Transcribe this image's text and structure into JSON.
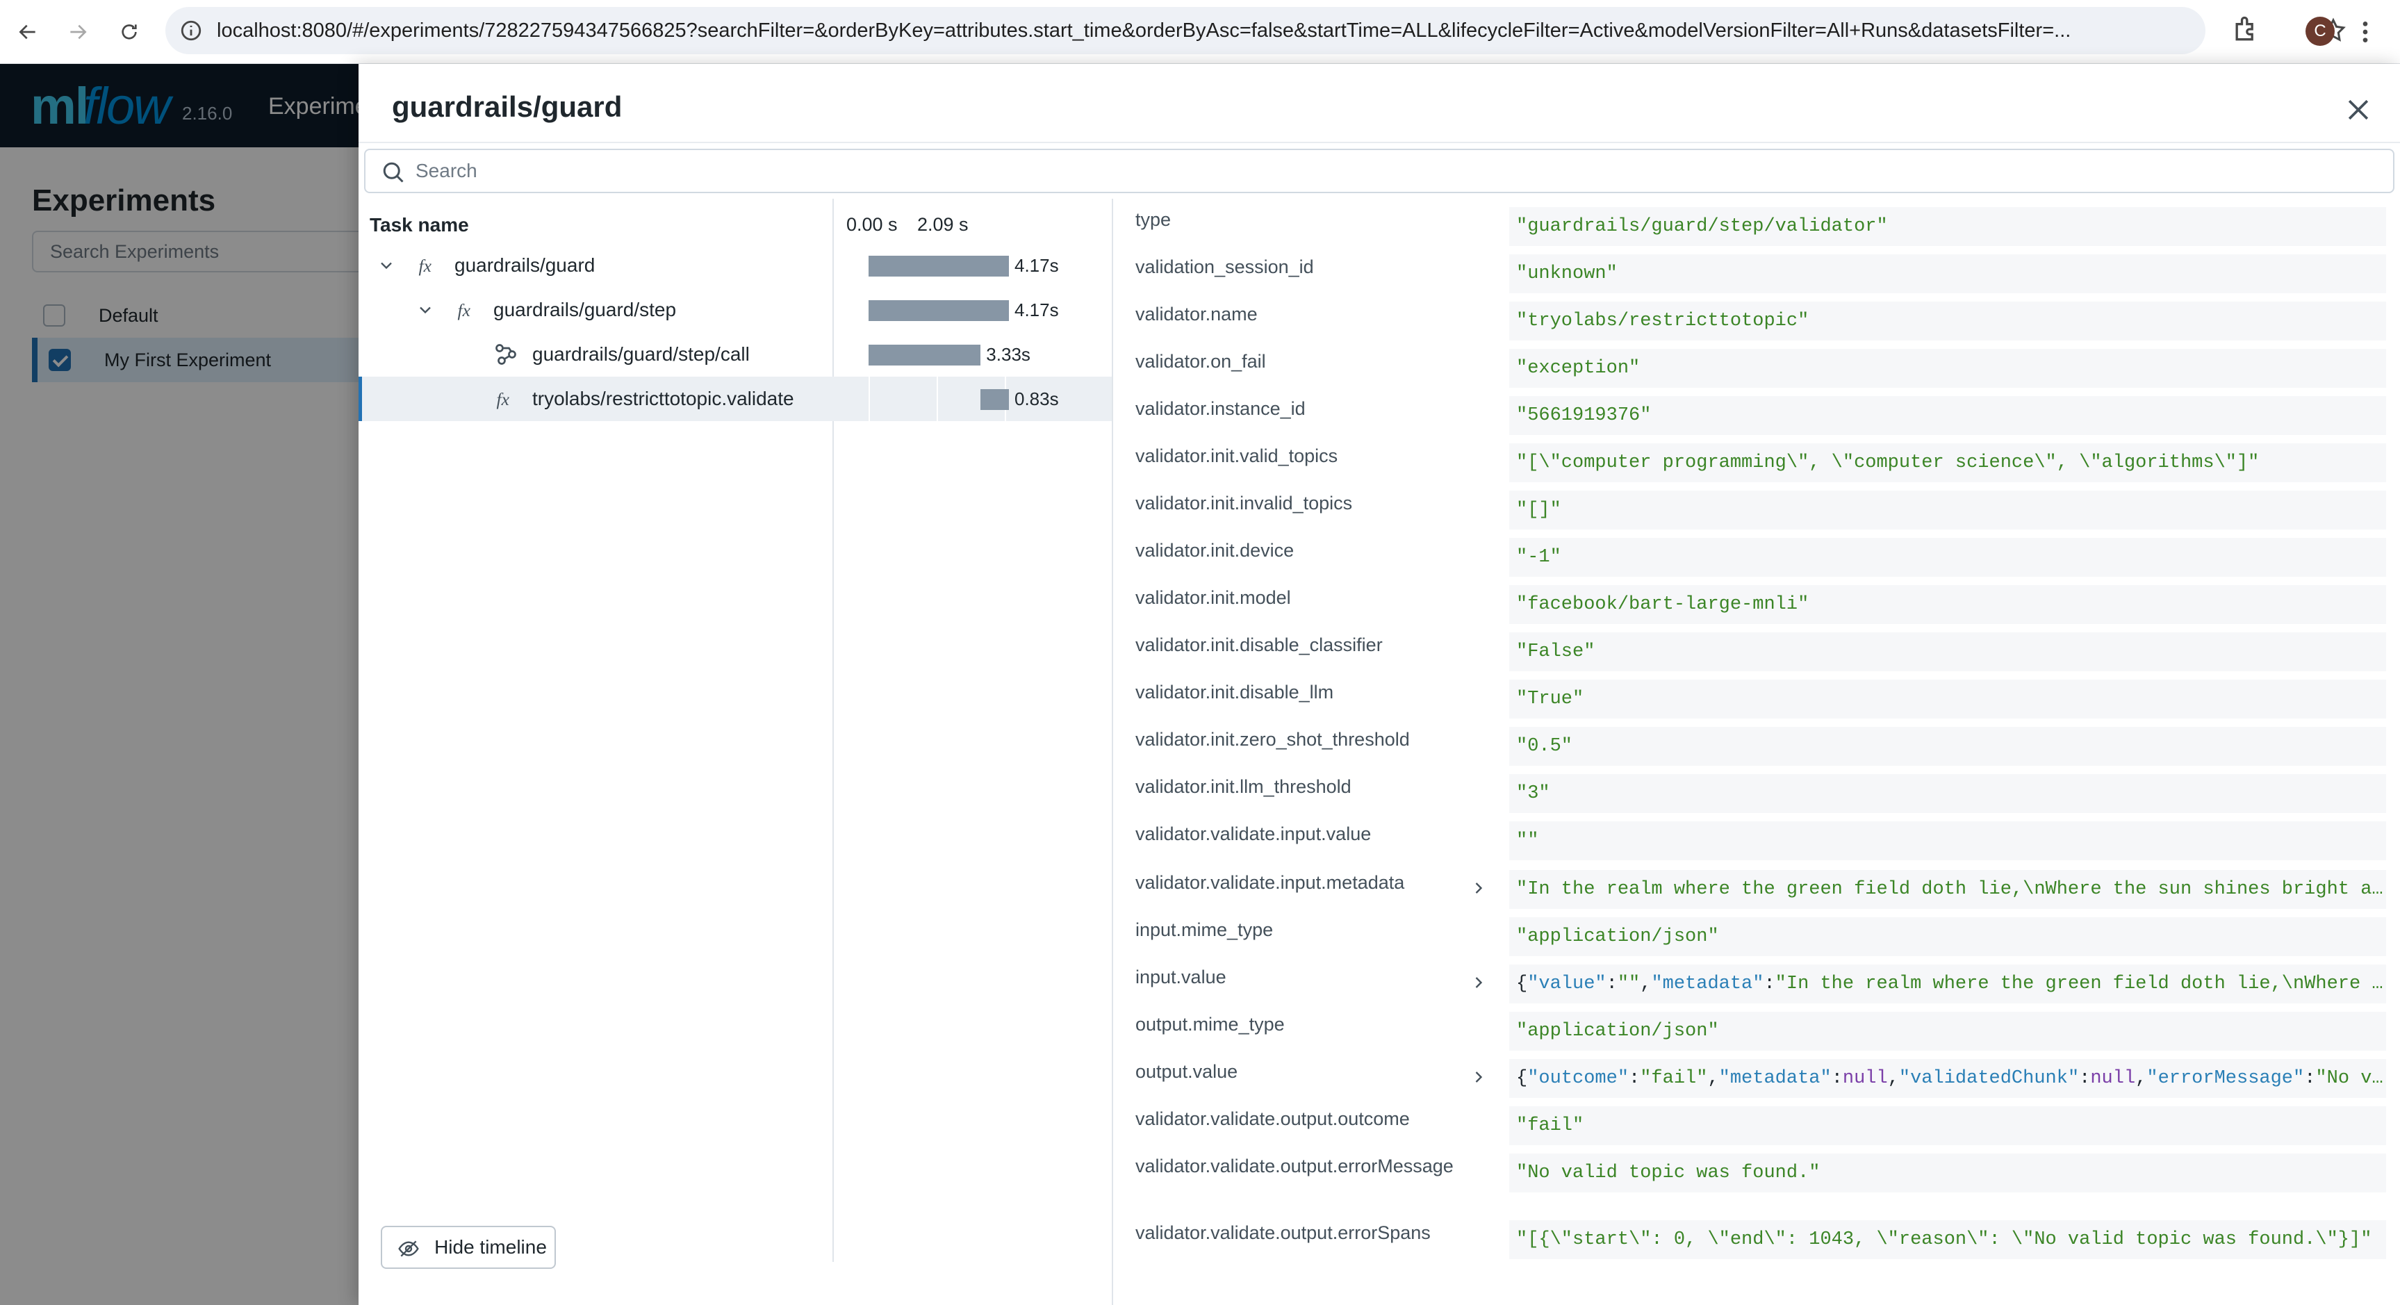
{
  "browser": {
    "url": "localhost:8080/#/experiments/728227594347566825?searchFilter=&orderByKey=attributes.start_time&orderByAsc=false&startTime=ALL&lifecycleFilter=Active&modelVersionFilter=All+Runs&datasetsFilter=...",
    "profile_initial": "C"
  },
  "app": {
    "logo_ml": "ml",
    "logo_flow": "flow",
    "version": "2.16.0",
    "nav_experiments": "Experiments",
    "experiments_title": "Experiments",
    "search_placeholder": "Search Experiments",
    "experiments": [
      {
        "label": "Default",
        "checked": false
      },
      {
        "label": "My First Experiment",
        "checked": true
      }
    ]
  },
  "drawer": {
    "title": "guardrails/guard",
    "search_placeholder": "Search",
    "task_name_header": "Task name",
    "timeline_start": "0.00 s",
    "timeline_mid": "2.09 s",
    "hide_timeline_label": "Hide timeline",
    "spans": [
      {
        "name": "guardrails/guard",
        "duration": "4.17s",
        "start": 0.0,
        "end": 4.17,
        "icon": "function-icon",
        "expandable": true
      },
      {
        "name": "guardrails/guard/step",
        "duration": "4.17s",
        "start": 0.0,
        "end": 4.17,
        "icon": "function-icon",
        "expandable": true
      },
      {
        "name": "guardrails/guard/step/call",
        "duration": "3.33s",
        "start": 0.0,
        "end": 3.33,
        "icon": "chain-icon",
        "expandable": false
      },
      {
        "name": "tryolabs/restricttotopic.validate",
        "duration": "0.83s",
        "start": 3.33,
        "end": 4.17,
        "icon": "function-icon",
        "expandable": false
      }
    ],
    "attributes": [
      {
        "key": "type",
        "value": "\"guardrails/guard/step/validator\"",
        "expandable": false
      },
      {
        "key": "validation_session_id",
        "value": "\"unknown\"",
        "expandable": false
      },
      {
        "key": "validator.name",
        "value": "\"tryolabs/restricttotopic\"",
        "expandable": false
      },
      {
        "key": "validator.on_fail",
        "value": "\"exception\"",
        "expandable": false
      },
      {
        "key": "validator.instance_id",
        "value": "\"5661919376\"",
        "expandable": false
      },
      {
        "key": "validator.init.valid_topics",
        "value": "\"[\\\"computer programming\\\", \\\"computer science\\\", \\\"algorithms\\\"]\"",
        "expandable": false
      },
      {
        "key": "validator.init.invalid_topics",
        "value": "\"[]\"",
        "expandable": false
      },
      {
        "key": "validator.init.device",
        "value": "\"-1\"",
        "expandable": false
      },
      {
        "key": "validator.init.model",
        "value": "\"facebook/bart-large-mnli\"",
        "expandable": false
      },
      {
        "key": "validator.init.disable_classifier",
        "value": "\"False\"",
        "expandable": false
      },
      {
        "key": "validator.init.disable_llm",
        "value": "\"True\"",
        "expandable": false
      },
      {
        "key": "validator.init.zero_shot_threshold",
        "value": "\"0.5\"",
        "expandable": false
      },
      {
        "key": "validator.init.llm_threshold",
        "value": "\"3\"",
        "expandable": false
      },
      {
        "key": "validator.validate.input.value",
        "value": "\"\"",
        "expandable": false
      },
      {
        "key": "validator.validate.input.metadata",
        "value": "\"In the realm where the green field doth lie,\\nWhere the sun shines bright and the sk…",
        "expandable": true
      },
      {
        "key": "input.mime_type",
        "value": "\"application/json\"",
        "expandable": false
      },
      {
        "key": "input.value",
        "value": "{\"value\":\"\",\"metadata\":\"In the realm where the green field doth lie,\\nWhere the sun s…",
        "expandable": true
      },
      {
        "key": "output.mime_type",
        "value": "\"application/json\"",
        "expandable": false
      },
      {
        "key": "output.value",
        "value": "{\"outcome\":\"fail\",\"metadata\":null,\"validatedChunk\":null,\"errorMessage\":\"No valid topi…",
        "expandable": true
      },
      {
        "key": "validator.validate.output.outcome",
        "value": "\"fail\"",
        "expandable": false
      },
      {
        "key": "validator.validate.output.errorMessage",
        "value": "\"No valid topic was found.\"",
        "expandable": false
      },
      {
        "key": "validator.validate.output.errorSpans",
        "value": "\"[{\\\"start\\\": 0, \\\"end\\\": 1043, \\\"reason\\\": \\\"No valid topic was found.\\\"}]\"",
        "expandable": false
      }
    ]
  },
  "colors": {
    "bar": "#8796a5",
    "selected_row": "#ebeff3",
    "accent": "#2272b4",
    "json_string": "#3b8526",
    "json_key": "#2a7fb6",
    "json_null": "#7b3fa8"
  }
}
